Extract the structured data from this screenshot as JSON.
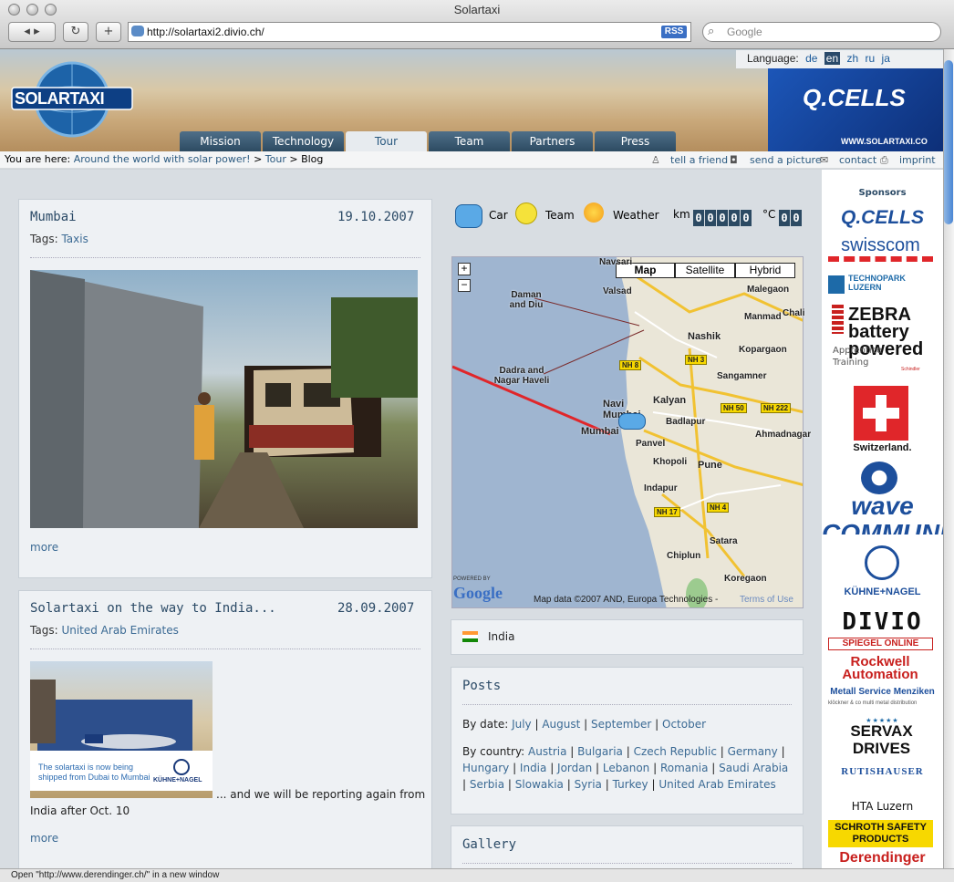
{
  "window": {
    "title": "Solartaxi"
  },
  "toolbar": {
    "url": "http://solartaxi2.divio.ch/",
    "rss": "RSS",
    "search_placeholder": "Google"
  },
  "language": {
    "label": "Language:",
    "options": [
      "de",
      "en",
      "zh",
      "ru",
      "ja"
    ],
    "selected": "en"
  },
  "logo": {
    "text": "SOLARTAXI"
  },
  "header_banner": {
    "brand": "Q.CELLS",
    "url": "WWW.SOLARTAXI.CO"
  },
  "nav": {
    "tabs": [
      "Mission",
      "Technology",
      "Tour",
      "Team",
      "Partners",
      "Press"
    ],
    "active": "Tour"
  },
  "breadcrumb": {
    "prefix": "You are here:",
    "items": [
      "Around the world with solar power!",
      "Tour",
      "Blog"
    ],
    "sep": ">"
  },
  "tools": {
    "tell_friend": "tell a friend",
    "send_picture": "send a picture",
    "contact": "contact",
    "imprint": "imprint"
  },
  "posts": [
    {
      "title": "Mumbai",
      "date": "19.10.2007",
      "tags_label": "Tags:",
      "tag": "Taxis",
      "more": "more"
    },
    {
      "title": "Solartaxi on the way to India...",
      "date": "28.09.2007",
      "tags_label": "Tags:",
      "tag": "United Arab Emirates",
      "photo_caption": "The solartaxi is now being shipped from Dubai to Mumbai",
      "photo_logo": "KÜHNE+NAGEL",
      "text_a": "... and we will be reporting again from",
      "text_b": "India after Oct. 10",
      "more": "more"
    }
  ],
  "status": {
    "car": "Car",
    "team": "Team",
    "weather": "Weather",
    "km_label": "km",
    "km_digits": [
      "0",
      "0",
      "0",
      "0",
      "0"
    ],
    "temp_label": "°C",
    "temp_digits": [
      "0",
      "0"
    ]
  },
  "map": {
    "types": [
      "Map",
      "Satellite",
      "Hybrid"
    ],
    "zoom_in": "+",
    "zoom_out": "−",
    "labels": [
      "Navsari",
      "Daman and Diu",
      "Valsad",
      "Malegaon",
      "Manmad",
      "Chali",
      "Dadra and Nagar Haveli",
      "Nashik",
      "Kopargaon",
      "Sangamner",
      "Kalyan",
      "Navi Mumbai",
      "Mumbai",
      "Badlapur",
      "Panvel",
      "Ahmadnagar",
      "Khopoli",
      "Pune",
      "Indapur",
      "Satara",
      "Chiplun",
      "Koregaon"
    ],
    "highways": [
      "NH 8",
      "NH 3",
      "NH 50",
      "NH 222",
      "NH 4",
      "NH 17"
    ],
    "powered": "POWERED BY",
    "google": "Google",
    "attribution": "Map data ©2007 AND, Europa Technologies -",
    "terms": "Terms of Use"
  },
  "country": {
    "name": "India"
  },
  "posts_box": {
    "title": "Posts",
    "by_date_label": "By date:",
    "months": [
      "July",
      "August",
      "September",
      "October"
    ],
    "by_country_label": "By country:",
    "countries": [
      "Austria",
      "Bulgaria",
      "Czech Republic",
      "Germany",
      "Hungary",
      "India",
      "Jordan",
      "Lebanon",
      "Romania",
      "Saudi Arabia",
      "Serbia",
      "Slowakia",
      "Syria",
      "Turkey",
      "United Arab Emirates"
    ]
  },
  "gallery": {
    "title": "Gallery"
  },
  "sponsors": {
    "title": "Sponsors",
    "items": [
      "Q.CELLS",
      "swisscom",
      "TECHNOPARK LUZERN",
      "ZEBRA battery powered",
      "Apprentice Training",
      "Schindler",
      "Switzerland.",
      "wave COMMUNICATION",
      "KÜHNE+NAGEL",
      "DIVIO",
      "SPIEGEL ONLINE",
      "Rockwell Automation",
      "Metall Service Menziken",
      "klöckner & co multi metal distribution",
      "SERVAX DRIVES",
      "RUTISHAUSER",
      "HTA Luzern",
      "SCHROTH SAFETY PRODUCTS",
      "Derendinger"
    ]
  },
  "statusbar": {
    "text": "Open \"http://www.derendinger.ch/\" in a new window"
  },
  "colors": {
    "accent": "#2b5a80",
    "nav": "#3d5d77",
    "route": "#e0262a"
  }
}
